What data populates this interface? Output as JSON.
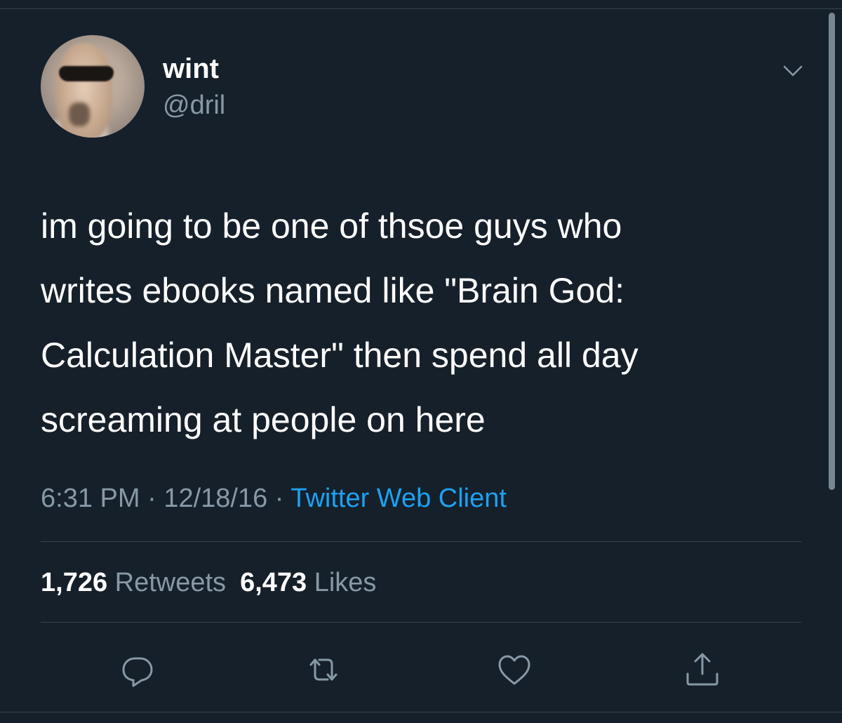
{
  "tweet": {
    "author": {
      "display_name": "wint",
      "handle": "@dril"
    },
    "text": "im going to be one of thsoe guys who\nwrites ebooks named like \"Brain God:\nCalculation Master\" then spend all day\nscreaming at people on here",
    "time": "6:31 PM",
    "date": "12/18/16",
    "client": "Twitter Web Client",
    "separator": "·",
    "stats": {
      "retweets_count": "1,726",
      "retweets_label": "Retweets",
      "likes_count": "6,473",
      "likes_label": "Likes"
    }
  },
  "actions": [
    {
      "icon": "reply-icon"
    },
    {
      "icon": "retweet-icon"
    },
    {
      "icon": "like-icon"
    },
    {
      "icon": "share-icon"
    }
  ],
  "colors": {
    "background": "#15202b",
    "text_primary": "#ffffff",
    "text_secondary": "#8899a6",
    "link": "#1da1f2",
    "divider": "#38444d"
  }
}
